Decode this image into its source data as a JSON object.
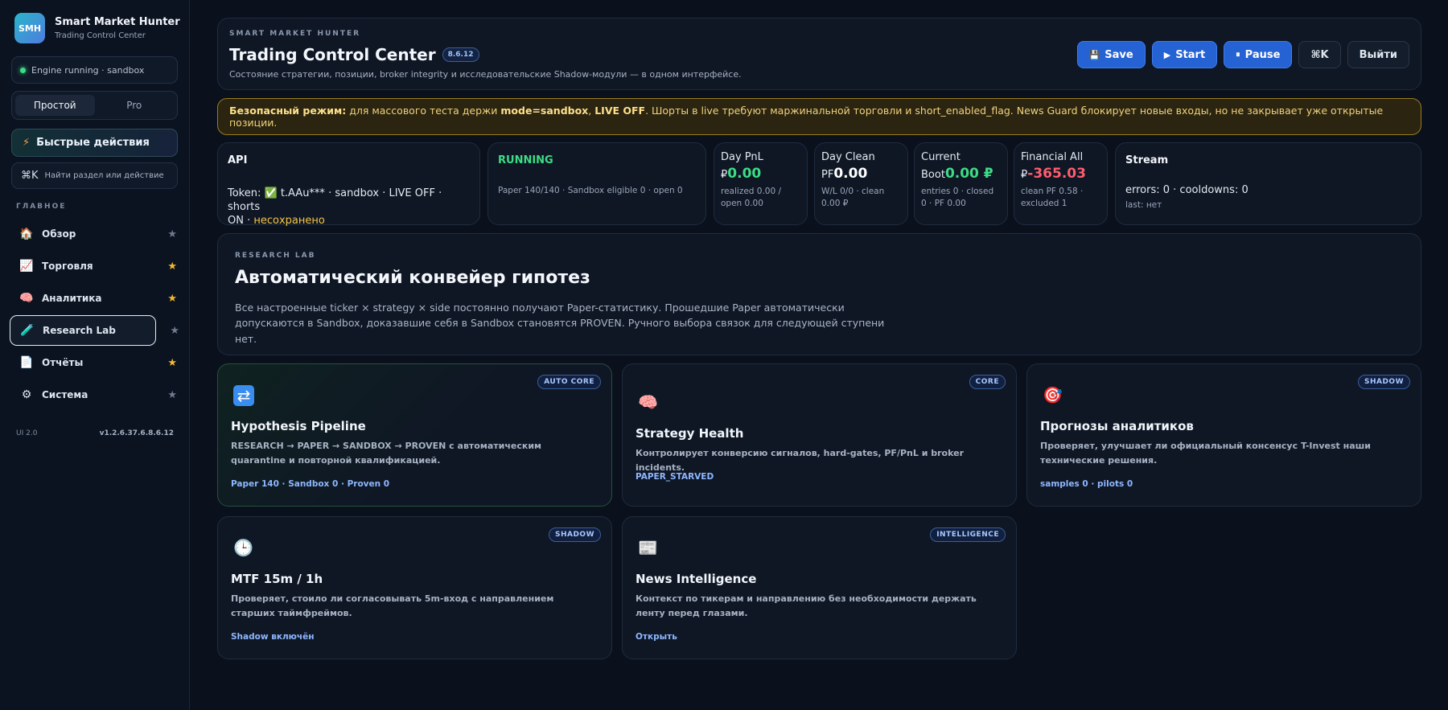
{
  "brand": {
    "logo": "SMH",
    "name": "Smart Market Hunter",
    "subtitle": "Trading Control Center"
  },
  "engine_status": "Engine running · sandbox",
  "mode_toggle": {
    "simple": "Простой",
    "pro": "Pro",
    "active": "simple"
  },
  "quick_actions": {
    "label": "Быстрые действия",
    "icon": "bolt-icon"
  },
  "search": {
    "kbd": "⌘K",
    "placeholder": "Найти раздел или действие"
  },
  "sidebar": {
    "section_label": "ГЛАВНОЕ",
    "items": [
      {
        "label": "Обзор",
        "icon": "home-icon",
        "starred": false
      },
      {
        "label": "Торговля",
        "icon": "chart-icon",
        "starred": true
      },
      {
        "label": "Аналитика",
        "icon": "brain-icon",
        "starred": true
      },
      {
        "label": "Research Lab",
        "icon": "test-tube-icon",
        "starred": false,
        "active": true
      },
      {
        "label": "Отчёты",
        "icon": "document-icon",
        "starred": true
      },
      {
        "label": "Система",
        "icon": "gear-icon",
        "starred": false
      }
    ],
    "footer_ui": "UI 2.0",
    "footer_version": "v1.2.6.37.6.8.6.12"
  },
  "header": {
    "eyebrow": "SMART MARKET HUNTER",
    "title": "Trading Control Center",
    "version": "8.6.12",
    "subtitle": "Состояние стратегии, позиции, broker integrity и исследовательские Shadow-модули — в одном интерфейсе.",
    "buttons": {
      "save": "Save",
      "start": "Start",
      "pause": "Pause",
      "kbd": "⌘K",
      "logout": "Выйти"
    }
  },
  "alert": {
    "lead": "Безопасный режим:",
    "text1": " для массового теста держи ",
    "mode": "mode=sandbox",
    "sep": ", ",
    "live": "LIVE OFF",
    "text2": ". Шорты в live требуют маржинальной торговли и short_enabled_flag. News Guard блокирует новые входы, но не закрывает уже открытые позиции."
  },
  "stats": {
    "api": {
      "title": "API",
      "line1": "Token: ✅ t.AAu*** · sandbox · LIVE OFF · shorts",
      "line2a": "ON · ",
      "line2b": "несохранено"
    },
    "running": {
      "title": "RUNNING",
      "detail": "Paper 140/140 · Sandbox eligible 0 · open 0"
    },
    "day_pnl": {
      "label": "Day PnL ₽",
      "value": "0.00",
      "detail": "realized 0.00 / open 0.00"
    },
    "day_clean": {
      "label": "Day Clean PF",
      "value": "0.00",
      "detail": "W/L 0/0 · clean 0.00 ₽"
    },
    "current_boot": {
      "label": "Current Boot",
      "value": "0.00 ₽",
      "detail": "entries 0 · closed 0 · PF 0.00"
    },
    "financial_all": {
      "label": "Financial All ₽",
      "value": "-365.03",
      "detail": "clean PF 0.58 · excluded 1"
    },
    "stream": {
      "title": "Stream",
      "line": "errors: 0 · cooldowns: 0",
      "last": "last: нет"
    }
  },
  "research_lab": {
    "eyebrow": "RESEARCH LAB",
    "title": "Автоматический конвейер гипотез",
    "description": "Все настроенные ticker × strategy × side постоянно получают Paper-статистику. Прошедшие Paper автоматически допускаются в Sandbox, доказавшие себя в Sandbox становятся PROVEN. Ручного выбора связок для следующей ступени нет."
  },
  "modules": [
    {
      "tag": "AUTO CORE",
      "icon": "cycle-icon",
      "title": "Hypothesis Pipeline",
      "description": "RESEARCH → PAPER → SANDBOX → PROVEN с автоматическим quarantine и повторной квалификацией.",
      "footer": "Paper 140 · Sandbox 0 · Proven 0"
    },
    {
      "tag": "CORE",
      "icon": "brain-icon",
      "title": "Strategy Health",
      "description": "Контролирует конверсию сигналов, hard-gates, PF/PnL и broker incidents.",
      "footer": "PAPER_STARVED"
    },
    {
      "tag": "SHADOW",
      "icon": "target-icon",
      "title": "Прогнозы аналитиков",
      "description": "Проверяет, улучшает ли официальный консенсус T-Invest наши технические решения.",
      "footer": "samples 0 · pilots 0"
    },
    {
      "tag": "SHADOW",
      "icon": "clock-icon",
      "title": "MTF 15m / 1h",
      "description": "Проверяет, стоило ли согласовывать 5m-вход с направлением старших таймфреймов.",
      "footer": "Shadow включён"
    },
    {
      "tag": "INTELLIGENCE",
      "icon": "newspaper-icon",
      "title": "News Intelligence",
      "description": "Контекст по тикерам и направлению без необходимости держать ленту перед глазами.",
      "footer": "Открыть"
    }
  ],
  "colors": {
    "accent": "#2563d4",
    "positive": "#3ddc84",
    "negative": "#ff5c6e",
    "warning": "#f5c542"
  }
}
